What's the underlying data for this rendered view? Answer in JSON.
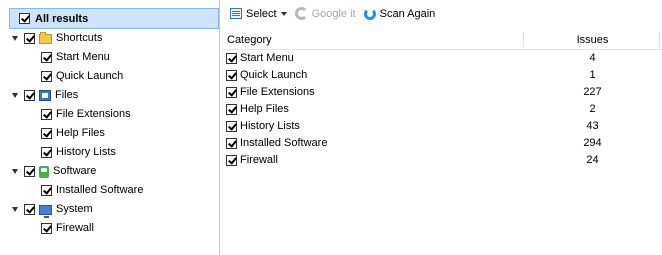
{
  "tree": {
    "all_results": "All results",
    "groups": [
      {
        "label": "Shortcuts",
        "icon": "folder-icon",
        "items": [
          "Start Menu",
          "Quick Launch"
        ]
      },
      {
        "label": "Files",
        "icon": "files-icon",
        "items": [
          "File Extensions",
          "Help Files",
          "History Lists"
        ]
      },
      {
        "label": "Software",
        "icon": "software-icon",
        "items": [
          "Installed Software"
        ]
      },
      {
        "label": "System",
        "icon": "system-icon",
        "items": [
          "Firewall"
        ]
      }
    ]
  },
  "toolbar": {
    "select_label": "Select",
    "google_label": "Google it",
    "scan_label": "Scan Again"
  },
  "table": {
    "columns": [
      "Category",
      "Issues"
    ],
    "rows": [
      {
        "category": "Start Menu",
        "issues": "4"
      },
      {
        "category": "Quick Launch",
        "issues": "1"
      },
      {
        "category": "File Extensions",
        "issues": "227"
      },
      {
        "category": "Help Files",
        "issues": "2"
      },
      {
        "category": "History Lists",
        "issues": "43"
      },
      {
        "category": "Installed Software",
        "issues": "294"
      },
      {
        "category": "Firewall",
        "issues": "24"
      }
    ]
  },
  "colors": {
    "selection_bg": "#cde3fa",
    "selection_border": "#8ab6ea",
    "accent": "#2a8fd8"
  }
}
